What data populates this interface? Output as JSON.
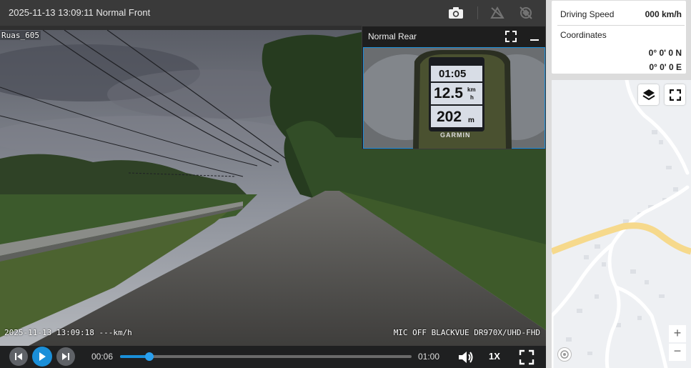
{
  "topbar": {
    "title": "2025-11-13 13:09:11 Normal Front",
    "snapshot_icon": "camera-icon",
    "location_icons": [
      "location-off-icon",
      "satellite-off-icon"
    ]
  },
  "video": {
    "camera_label": "Ruas_605",
    "osd_left": "2025-11-13 13:09:18 ---km/h",
    "osd_right": "MIC OFF BLACKVUE DR970X/UHD-FHD"
  },
  "pip": {
    "title": "Normal Rear",
    "gps_time": "01:05",
    "gps_speed": "12.5",
    "gps_speed_unit_top": "km",
    "gps_speed_unit_bottom": "h",
    "gps_elev": "202",
    "gps_elev_unit": "m",
    "gps_brand": "GARMIN"
  },
  "player": {
    "current_time": "00:06",
    "duration": "01:00",
    "progress": 0.1,
    "speed": "1X"
  },
  "info": {
    "speed_label": "Driving Speed",
    "speed_value": "000 km/h",
    "coords_label": "Coordinates",
    "lat": "0° 0'   0 N",
    "lon": "0° 0'   0 E"
  },
  "map": {
    "zoom_in": "+",
    "zoom_out": "−"
  },
  "colors": {
    "accent": "#1a8fd9",
    "pip_border": "#1a8fd9",
    "map_road_major": "#f6d98c"
  }
}
